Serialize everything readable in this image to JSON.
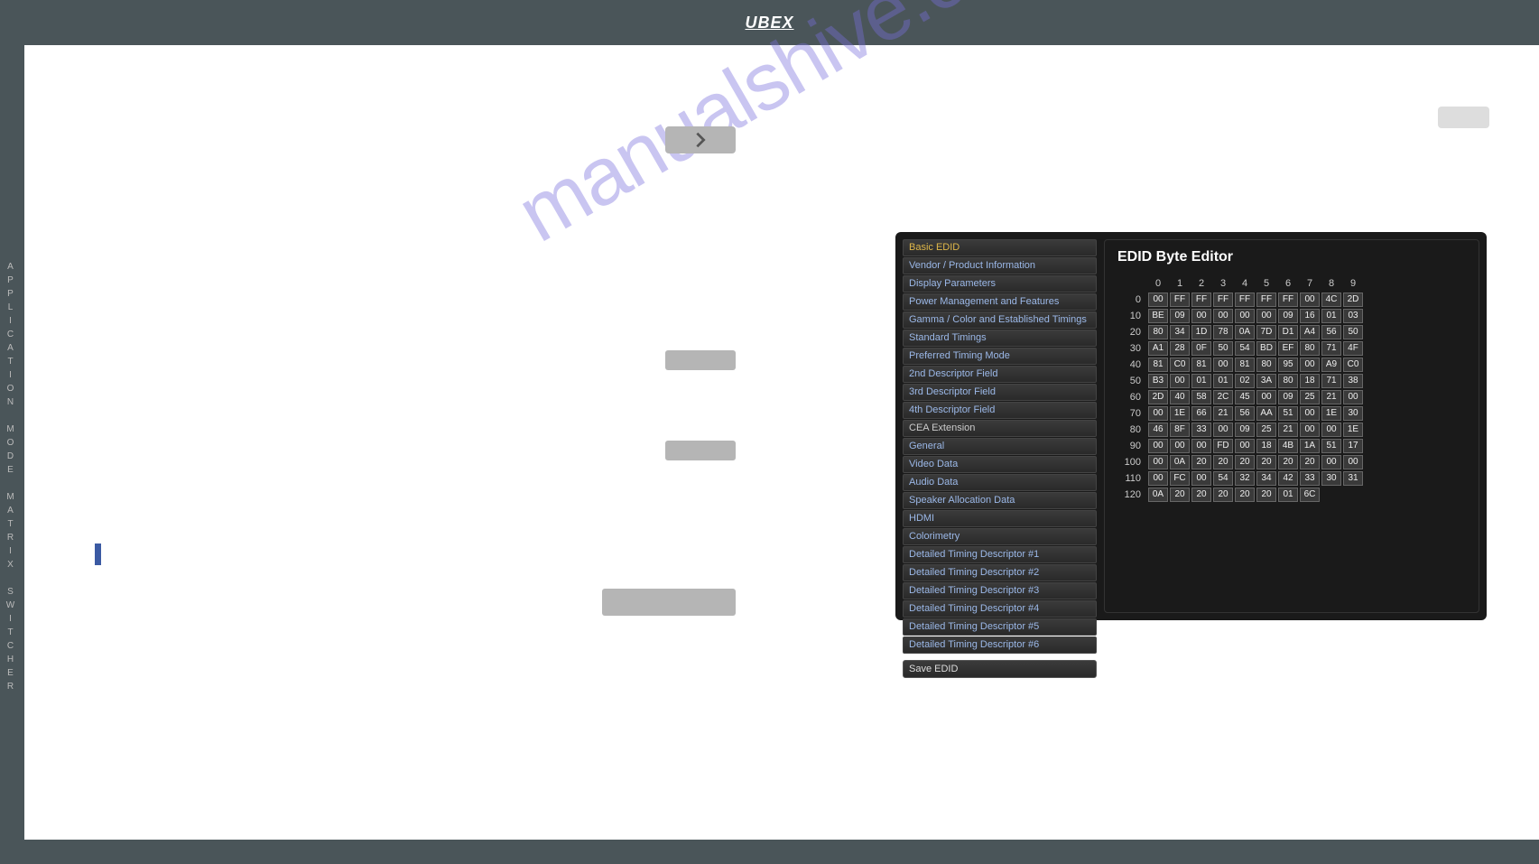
{
  "logo": "UBEX",
  "sidebar_text": "APPLICATION MODE  MATRIX SWITCHER",
  "watermark": "manualshive.com",
  "edid": {
    "title": "EDID Byte Editor",
    "left_groups": [
      {
        "header": null,
        "items": [
          {
            "label": "Basic EDID",
            "active": true
          },
          {
            "label": "Vendor / Product Information"
          },
          {
            "label": "Display Parameters"
          },
          {
            "label": "Power Management and Features"
          },
          {
            "label": "Gamma / Color and Established Timings"
          },
          {
            "label": "Standard Timings"
          },
          {
            "label": "Preferred Timing Mode"
          },
          {
            "label": "2nd Descriptor Field"
          },
          {
            "label": "3rd Descriptor Field"
          },
          {
            "label": "4th Descriptor Field"
          }
        ]
      },
      {
        "header": "CEA Extension",
        "items": [
          {
            "label": "General"
          },
          {
            "label": "Video Data"
          },
          {
            "label": "Audio Data"
          },
          {
            "label": "Speaker Allocation Data"
          },
          {
            "label": "HDMI"
          },
          {
            "label": "Colorimetry"
          },
          {
            "label": "Detailed Timing Descriptor #1"
          },
          {
            "label": "Detailed Timing Descriptor #2"
          },
          {
            "label": "Detailed Timing Descriptor #3"
          },
          {
            "label": "Detailed Timing Descriptor #4"
          },
          {
            "label": "Detailed Timing Descriptor #5"
          },
          {
            "label": "Detailed Timing Descriptor #6"
          }
        ]
      }
    ],
    "save_label": "Save EDID",
    "col_headers": [
      "0",
      "1",
      "2",
      "3",
      "4",
      "5",
      "6",
      "7",
      "8",
      "9"
    ],
    "rows": [
      {
        "h": "0",
        "c": [
          "00",
          "FF",
          "FF",
          "FF",
          "FF",
          "FF",
          "FF",
          "00",
          "4C",
          "2D"
        ]
      },
      {
        "h": "10",
        "c": [
          "BE",
          "09",
          "00",
          "00",
          "00",
          "00",
          "09",
          "16",
          "01",
          "03"
        ]
      },
      {
        "h": "20",
        "c": [
          "80",
          "34",
          "1D",
          "78",
          "0A",
          "7D",
          "D1",
          "A4",
          "56",
          "50"
        ]
      },
      {
        "h": "30",
        "c": [
          "A1",
          "28",
          "0F",
          "50",
          "54",
          "BD",
          "EF",
          "80",
          "71",
          "4F"
        ]
      },
      {
        "h": "40",
        "c": [
          "81",
          "C0",
          "81",
          "00",
          "81",
          "80",
          "95",
          "00",
          "A9",
          "C0"
        ]
      },
      {
        "h": "50",
        "c": [
          "B3",
          "00",
          "01",
          "01",
          "02",
          "3A",
          "80",
          "18",
          "71",
          "38"
        ]
      },
      {
        "h": "60",
        "c": [
          "2D",
          "40",
          "58",
          "2C",
          "45",
          "00",
          "09",
          "25",
          "21",
          "00"
        ]
      },
      {
        "h": "70",
        "c": [
          "00",
          "1E",
          "66",
          "21",
          "56",
          "AA",
          "51",
          "00",
          "1E",
          "30"
        ]
      },
      {
        "h": "80",
        "c": [
          "46",
          "8F",
          "33",
          "00",
          "09",
          "25",
          "21",
          "00",
          "00",
          "1E"
        ]
      },
      {
        "h": "90",
        "c": [
          "00",
          "00",
          "00",
          "FD",
          "00",
          "18",
          "4B",
          "1A",
          "51",
          "17"
        ]
      },
      {
        "h": "100",
        "c": [
          "00",
          "0A",
          "20",
          "20",
          "20",
          "20",
          "20",
          "20",
          "00",
          "00"
        ]
      },
      {
        "h": "110",
        "c": [
          "00",
          "FC",
          "00",
          "54",
          "32",
          "34",
          "42",
          "33",
          "30",
          "31"
        ]
      },
      {
        "h": "120",
        "c": [
          "0A",
          "20",
          "20",
          "20",
          "20",
          "20",
          "01",
          "6C"
        ]
      }
    ]
  }
}
